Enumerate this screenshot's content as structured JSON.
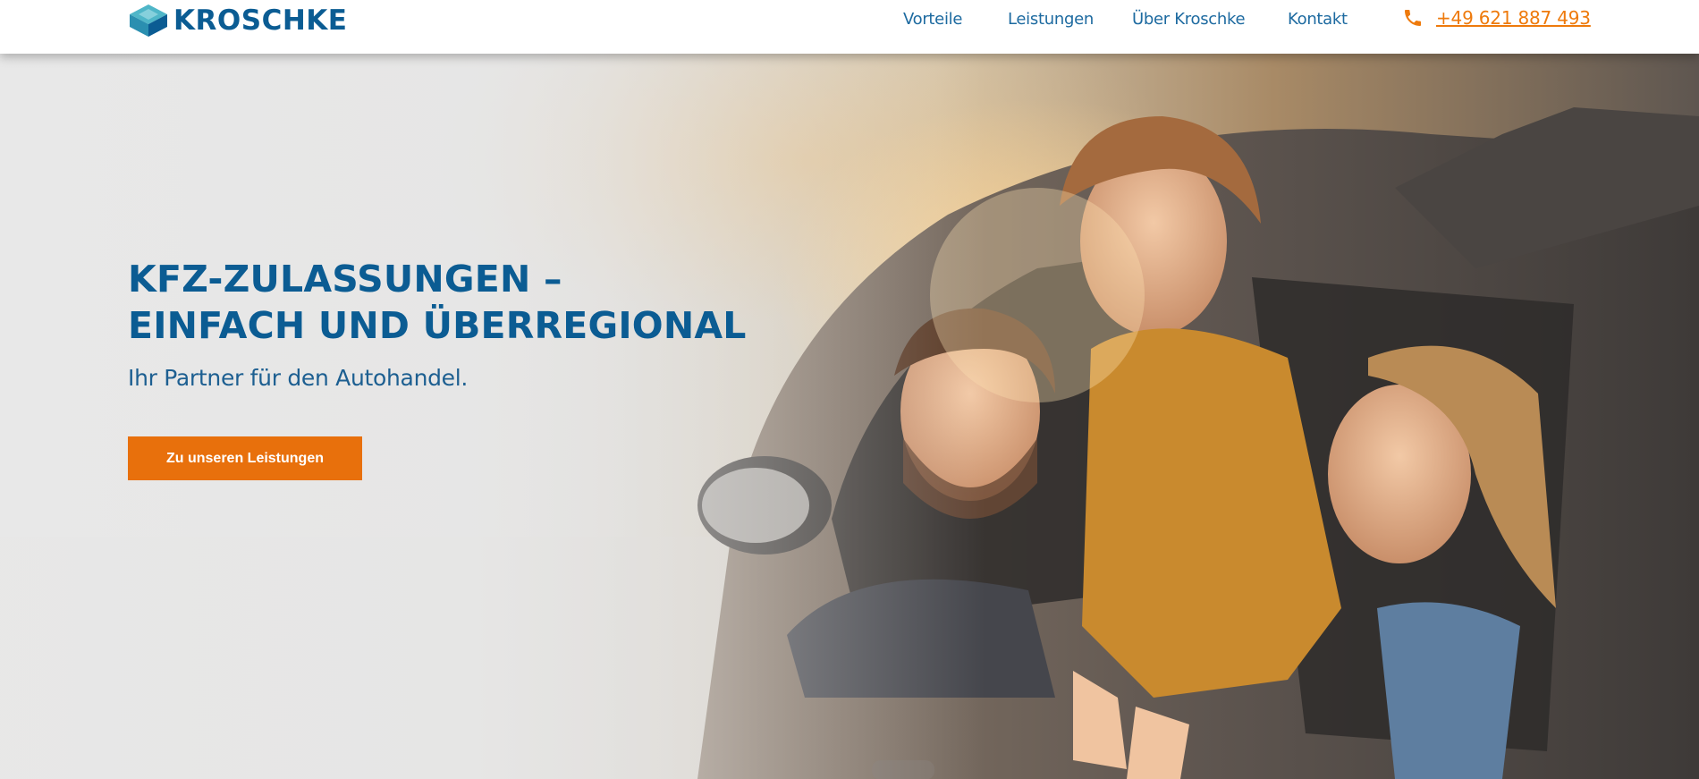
{
  "header": {
    "logo_text": "KROSCHKE",
    "nav": [
      {
        "label": "Vorteile"
      },
      {
        "label": "Leistungen"
      },
      {
        "label": "Über Kroschke"
      },
      {
        "label": "Kontakt"
      }
    ],
    "phone": "+49 621 887 493"
  },
  "hero": {
    "headline_line1": "KFZ-ZULASSUNGEN –",
    "headline_line2": "EINFACH UND ÜBERREGIONAL",
    "subline": "Ihr Partner für den Autohandel.",
    "cta_label": "Zu unseren Leistungen",
    "image_semantic": "family-in-car-photo"
  },
  "colors": {
    "brand_blue": "#0b5c93",
    "nav_blue": "#1d6aa0",
    "accent_orange": "#e8700c",
    "phone_orange": "#ee7a0c",
    "header_bg": "#ffffff"
  },
  "icons": {
    "logo": "kroschke-cube-logo-icon",
    "phone": "phone-icon"
  }
}
